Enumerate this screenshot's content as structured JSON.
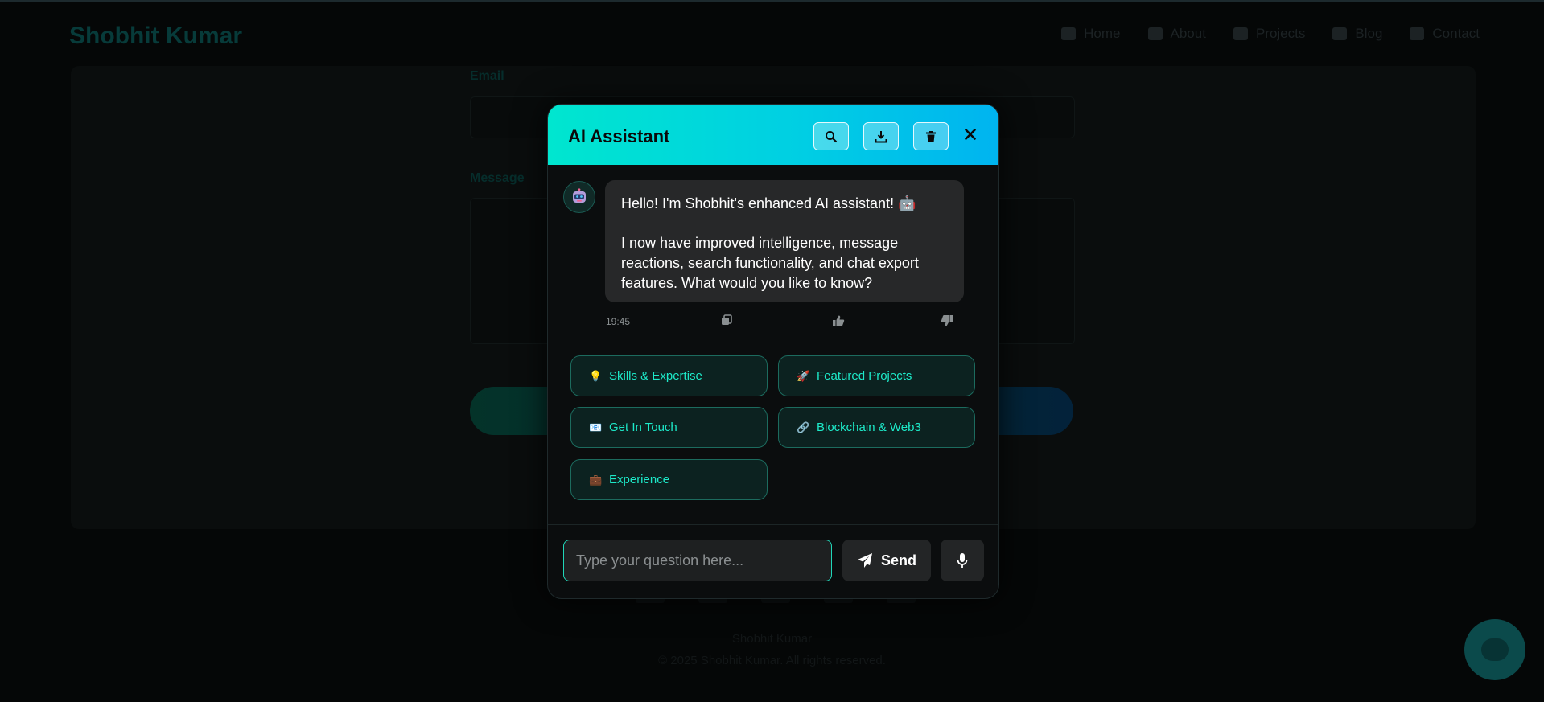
{
  "background": {
    "logo": "Shobhit Kumar",
    "nav": [
      "Home",
      "About",
      "Projects",
      "Blog",
      "Contact"
    ],
    "form_labels": {
      "email": "Email",
      "message": "Message"
    },
    "footer_name": "Shobhit Kumar",
    "footer_copy": "© 2025 Shobhit Kumar. All rights reserved."
  },
  "chat": {
    "title": "AI Assistant",
    "header_icons": [
      "search-icon",
      "download-icon",
      "trash-icon",
      "close-icon"
    ],
    "message": {
      "line1": "Hello! I'm Shobhit's enhanced AI assistant! 🤖",
      "line2": "I now have improved intelligence, message reactions, search functionality, and chat export features. What would you like to know?",
      "time": "19:45"
    },
    "suggestions": [
      {
        "icon": "💡",
        "label": "Skills & Expertise"
      },
      {
        "icon": "🚀",
        "label": "Featured Projects"
      },
      {
        "icon": "📧",
        "label": "Get In Touch"
      },
      {
        "icon": "🔗",
        "label": "Blockchain & Web3"
      },
      {
        "icon": "💼",
        "label": "Experience"
      }
    ],
    "input_placeholder": "Type your question here...",
    "send_label": "Send"
  },
  "colors": {
    "accent": "#1de9c8",
    "header_gradient_start": "#00e6cf",
    "header_gradient_end": "#00b4f0"
  }
}
